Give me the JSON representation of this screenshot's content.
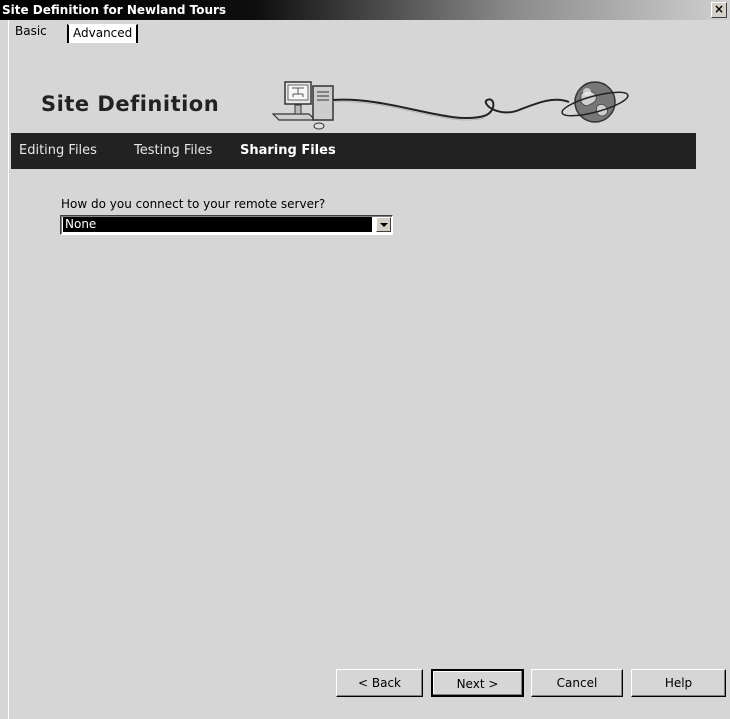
{
  "window": {
    "title": "Site Definition for Newland Tours",
    "close_glyph": "×"
  },
  "tabs": [
    {
      "label": "Basic"
    },
    {
      "label": "Advanced"
    }
  ],
  "header": {
    "title": "Site Definition"
  },
  "nav": [
    {
      "label": "Editing Files",
      "active": false
    },
    {
      "label": "Testing Files",
      "active": false
    },
    {
      "label": "Sharing Files",
      "active": true
    }
  ],
  "form": {
    "question": "How do you connect to your remote server?",
    "connection_selected": "None"
  },
  "buttons": {
    "back": "< Back",
    "next": "Next >",
    "cancel": "Cancel",
    "help": "Help"
  },
  "icons": {
    "header_graphic": "computer-cable-globe-icon",
    "dropdown": "dropdown-arrow-icon"
  }
}
